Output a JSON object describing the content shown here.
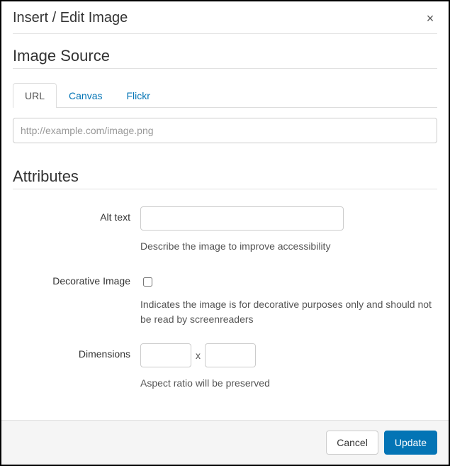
{
  "dialog": {
    "title": "Insert / Edit Image",
    "close_glyph": "×"
  },
  "source": {
    "heading": "Image Source",
    "tabs": [
      {
        "label": "URL",
        "active": true
      },
      {
        "label": "Canvas",
        "active": false
      },
      {
        "label": "Flickr",
        "active": false
      }
    ],
    "url_placeholder": "http://example.com/image.png",
    "url_value": ""
  },
  "attributes": {
    "heading": "Attributes",
    "alt": {
      "label": "Alt text",
      "value": "",
      "help": "Describe the image to improve accessibility"
    },
    "decorative": {
      "label": "Decorative Image",
      "checked": false,
      "help": "Indicates the image is for decorative purposes only and should not be read by screenreaders"
    },
    "dimensions": {
      "label": "Dimensions",
      "width": "",
      "height": "",
      "separator": "x",
      "help": "Aspect ratio will be preserved"
    }
  },
  "footer": {
    "cancel": "Cancel",
    "update": "Update"
  }
}
